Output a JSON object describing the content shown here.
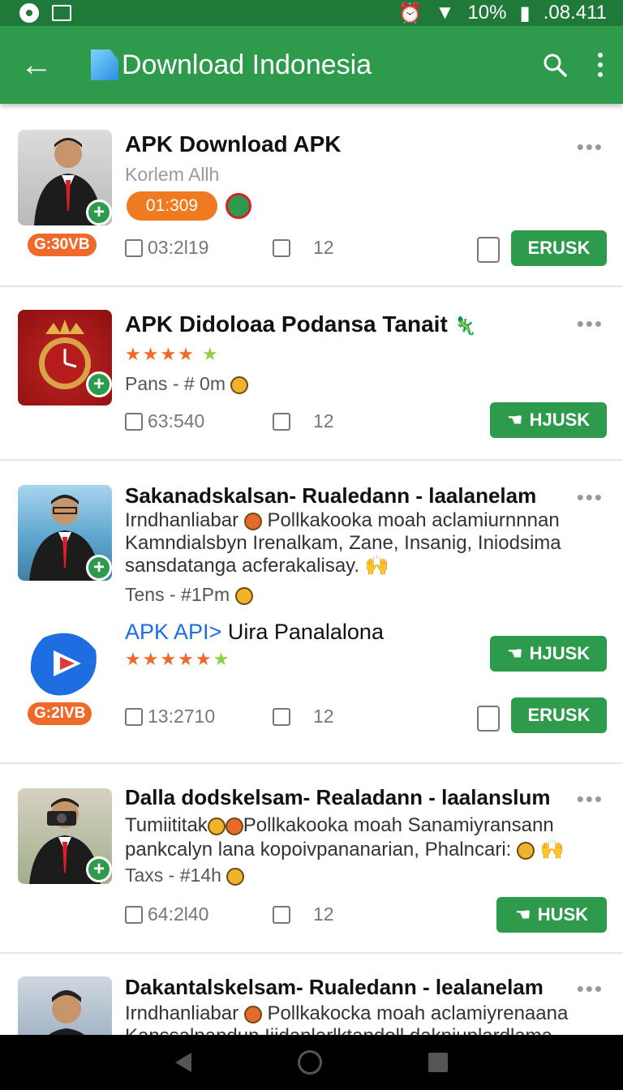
{
  "status": {
    "battery": "10%",
    "time": ".08.411"
  },
  "app_title": "Download Indonesia",
  "items": [
    {
      "title": "APK Download APK",
      "subtitle": "Korlem Allh",
      "pill": "01:309",
      "size": "G:30VB",
      "stat1": "03:2l19",
      "stat2": "12",
      "button": "ERUSK"
    },
    {
      "title": "APK Didoloaa Podansa Tanait",
      "meta": "Pans - # 0m",
      "stat1": "63:540",
      "stat2": "12",
      "button": "HJUSK"
    },
    {
      "title": "Sakanadskalsan- Rualedann - laalanelam",
      "desc1": "Irndhanliabar",
      "desc1b": "Pollkakooka moah aclamiurnnnan",
      "desc2": "Kamndialsbyn Irenalkam, Zane, Insanig, Iniodsima",
      "desc3": "sansdatanga acferakalisay.",
      "meta": "Tens - #1Pm",
      "sub_title_a": "APK API>",
      "sub_title_b": " Uira Panalalona",
      "button1": "HJUSK",
      "size": "G:2lVB",
      "stat1": "13:2710",
      "stat2": "12",
      "button2": "ERUSK"
    },
    {
      "title": "Dalla dodskelsam- Realadann - laalanslum",
      "desc1": "Tumiititak",
      "desc1b": "Pollkakooka moah Sanamiyransann",
      "desc2": "pankcalyn lana kopoivpananarian, Phalncari:",
      "meta": "Taxs - #14h",
      "stat1": "64:2l40",
      "stat2": "12",
      "button": "HUSK"
    },
    {
      "title": "Dakantalskelsam- Rualedann - lealanelam",
      "desc1": "Irndhanliabar",
      "desc1b": "Pollkakocka moah aclamiyrenaana",
      "desc2": "Kanssalpandun Ijidanlarlktandoll dakniuplardlama"
    }
  ]
}
